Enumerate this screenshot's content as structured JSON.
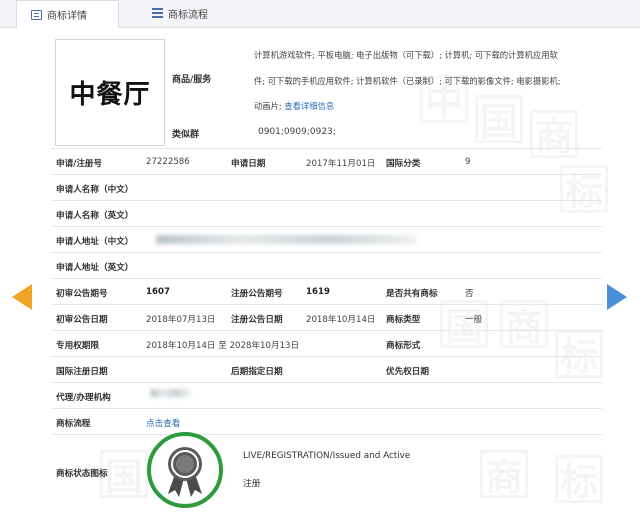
{
  "tabs": [
    {
      "label": "商标详情",
      "icon": "document-icon"
    },
    {
      "label": "商标流程",
      "icon": "list-icon"
    }
  ],
  "trademark": {
    "name": "中餐厅",
    "goods_label": "商品/服务",
    "goods_lines": [
      "计算机游戏软件; 平板电脑; 电子出版物（可下载）; 计算机; 可下载的计算机应用软",
      "件; 可下载的手机应用软件; 计算机软件（已录制）; 可下载的影像文件; 电影摄影机;",
      "动画片;"
    ],
    "goods_link": "查看详细信息",
    "similar_label": "类似群",
    "similar_value": "0901;0909;0923;"
  },
  "fields": {
    "reg_no_label": "申请/注册号",
    "reg_no": "27222586",
    "apply_date_label": "申请日期",
    "apply_date": "2017年11月01日",
    "intl_class_label": "国际分类",
    "intl_class": "9",
    "applicant_cn_label": "申请人名称（中文）",
    "applicant_en_label": "申请人名称（英文）",
    "address_cn_label": "申请人地址（中文）",
    "address_en_label": "申请人地址（英文）",
    "prelim_no_label": "初审公告期号",
    "prelim_no": "1607",
    "reg_pub_no_label": "注册公告期号",
    "reg_pub_no": "1619",
    "shared_label": "是否共有商标",
    "shared": "否",
    "prelim_date_label": "初审公告日期",
    "prelim_date": "2018年07月13日",
    "reg_pub_date_label": "注册公告日期",
    "reg_pub_date": "2018年10月14日",
    "mark_type_label": "商标类型",
    "mark_type": "一般",
    "exclusive_label": "专用权期限",
    "exclusive": "2018年10月14日 至 2028年10月13日",
    "mark_form_label": "商标形式",
    "intl_reg_date_label": "国际注册日期",
    "late_date_label": "后期指定日期",
    "priority_label": "优先权日期",
    "agent_label": "代理/办理机构",
    "process_label": "商标流程",
    "process_link": "点击查看",
    "status_icon_label": "商标状态图标",
    "status_en": "LIVE/REGISTRATION/Issued and Active",
    "status_cn": "注册"
  },
  "colors": {
    "link": "#2a6ebb",
    "status_green": "#2e9a3d",
    "prev_arrow": "#f0a326",
    "next_arrow": "#4b8fd6"
  }
}
